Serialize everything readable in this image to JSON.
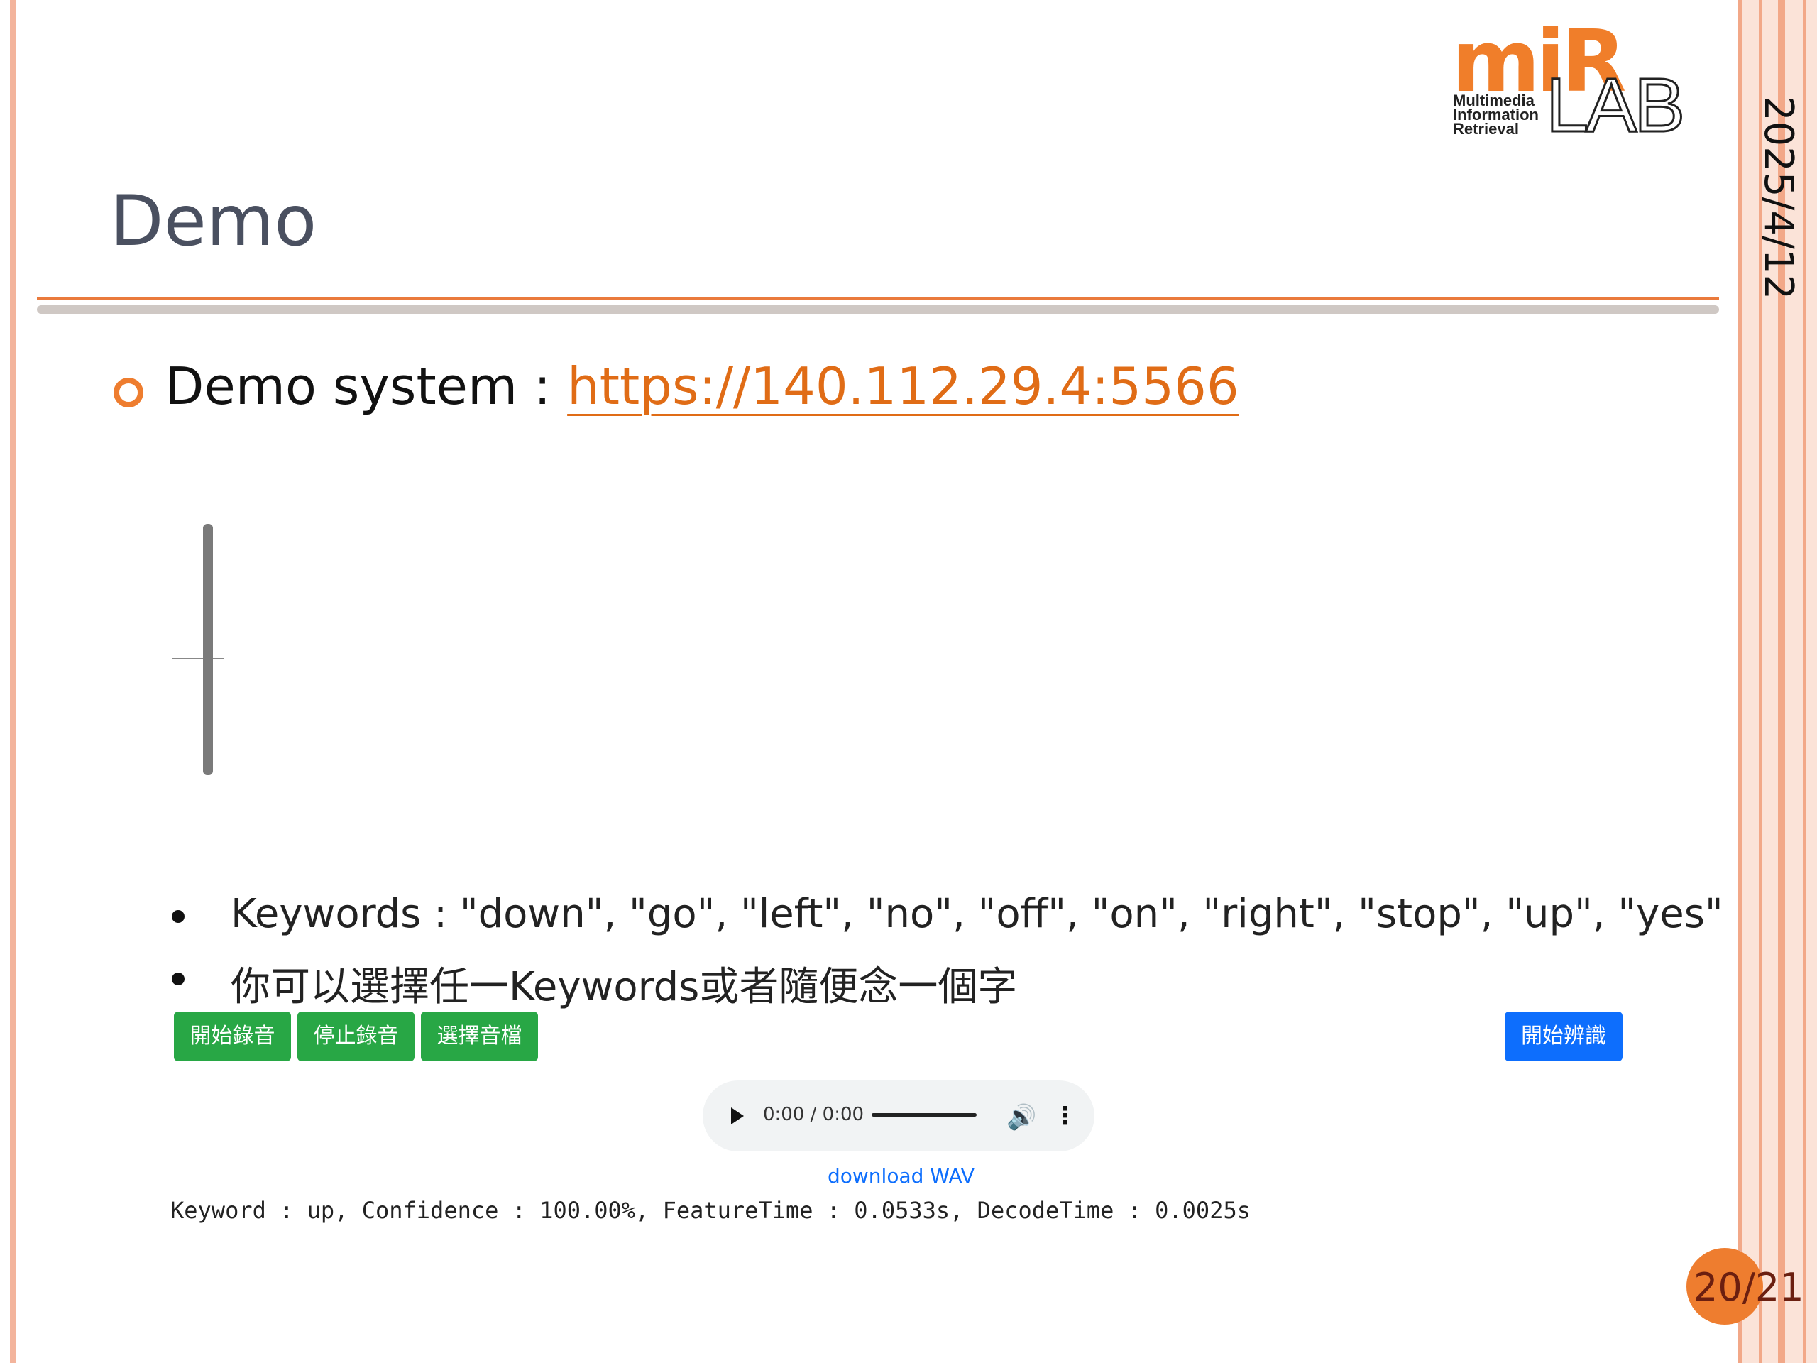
{
  "slide": {
    "title": "Demo",
    "date": "2025/4/12",
    "page_number": "20/21"
  },
  "logo": {
    "mir": "miR",
    "subtitle_lines": [
      "Multimedia",
      "Information",
      "Retrieval"
    ],
    "lab": "LAB"
  },
  "bullet": {
    "label": "Demo system : ",
    "link_text": "https://140.112.29.4:5566"
  },
  "notes": [
    "Keywords : \"down\", \"go\", \"left\", \"no\", \"off\", \"on\", \"right\", \"stop\", \"up\", \"yes\"",
    "你可以選擇任一Keywords或者隨便念一個字"
  ],
  "buttons": {
    "start_record": "開始錄音",
    "stop_record": "停止錄音",
    "choose_file": "選擇音檔",
    "recognize": "開始辨識"
  },
  "player": {
    "time": "0:00 / 0:00"
  },
  "download_label": "download WAV",
  "result_text": "Keyword : up, Confidence : 100.00%, FeatureTime : 0.0533s, DecodeTime : 0.0025s",
  "colors": {
    "accent": "#ee7d2f",
    "button_green": "#28a745",
    "button_blue": "#0d6efd"
  }
}
